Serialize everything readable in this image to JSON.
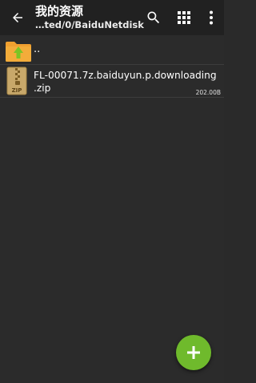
{
  "appbar": {
    "title": "我的资源",
    "path": "…ted/0/BaiduNetdisk",
    "back_icon": "arrow-back-icon",
    "search_icon": "search-icon",
    "grid_icon": "grid-view-icon",
    "more_icon": "more-vert-icon"
  },
  "list": {
    "parent": {
      "label": "..",
      "icon": "folder-up-icon"
    },
    "files": [
      {
        "name_line1": "FL-00071.7z.baiduyun.p.downloading",
        "name_line2": ".zip",
        "size": "202.00B",
        "icon": "zip-file-icon",
        "icon_text": "ZIP"
      }
    ]
  },
  "fab": {
    "icon": "add-icon"
  },
  "colors": {
    "background": "#2b2b2b",
    "appbar": "#212121",
    "fab": "#6fba2c",
    "folder": "#f0a030",
    "folder_arrow": "#7cc424"
  }
}
